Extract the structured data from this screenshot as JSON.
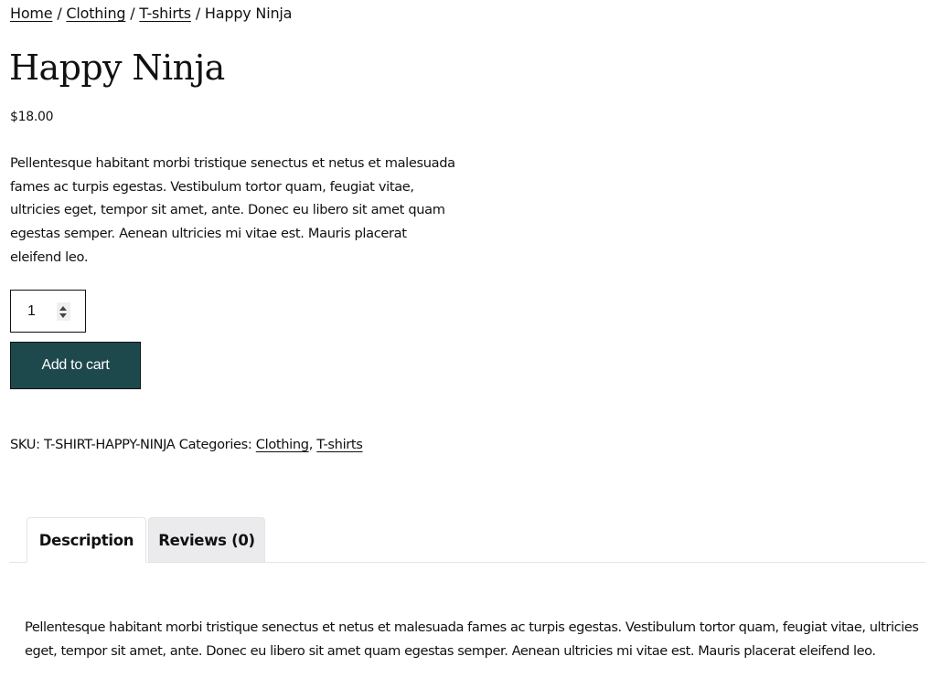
{
  "breadcrumb": {
    "items": [
      {
        "label": "Home",
        "link": true
      },
      {
        "label": "Clothing",
        "link": true
      },
      {
        "label": "T-shirts",
        "link": true
      },
      {
        "label": "Happy Ninja",
        "link": false
      }
    ],
    "separator": " / "
  },
  "product": {
    "title": "Happy Ninja",
    "price": "$18.00",
    "short_description": "Pellentesque habitant morbi tristique senectus et netus et malesuada fames ac turpis egestas. Vestibulum tortor quam, feugiat vitae, ultricies eget, tempor sit amet, ante. Donec eu libero sit amet quam egestas semper. Aenean ultricies mi vitae est. Mauris placerat eleifend leo.",
    "quantity": "1",
    "add_to_cart_label": "Add to cart",
    "button_color": "#1d484c"
  },
  "meta": {
    "sku_label": "SKU:",
    "sku_value": "T-SHIRT-HAPPY-NINJA",
    "categories_label": "Categories:",
    "categories": [
      "Clothing",
      "T-shirts"
    ],
    "category_separator": ", "
  },
  "tabs": [
    {
      "label": "Description",
      "active": true
    },
    {
      "label": "Reviews (0)",
      "active": false
    }
  ],
  "description_panel": {
    "text": "Pellentesque habitant morbi tristique senectus et netus et malesuada fames ac turpis egestas. Vestibulum tortor quam, feugiat vitae, ultricies eget, tempor sit amet, ante. Donec eu libero sit amet quam egestas semper. Aenean ultricies mi vitae est. Mauris placerat eleifend leo."
  }
}
